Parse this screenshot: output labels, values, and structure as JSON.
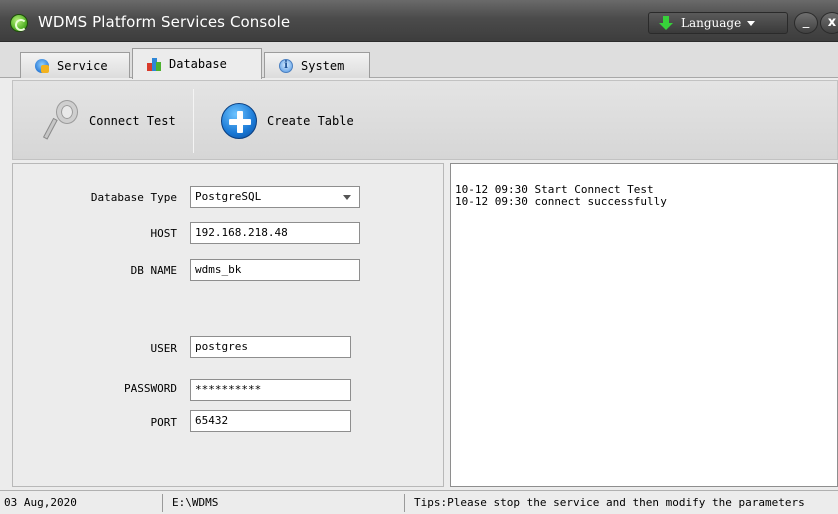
{
  "window": {
    "title": "WDMS Platform Services Console",
    "language_label": "Language",
    "minimize_glyph": "_",
    "close_glyph": "x"
  },
  "tabs": [
    {
      "label": "Service",
      "icon": "service-icon",
      "active": false
    },
    {
      "label": "Database",
      "icon": "database-icon",
      "active": true
    },
    {
      "label": "System",
      "icon": "info-icon",
      "active": false
    }
  ],
  "toolbar": {
    "connect_test_label": "Connect Test",
    "create_table_label": "Create Table"
  },
  "form": {
    "database_type_label": "Database Type",
    "database_type_value": "PostgreSQL",
    "host_label": "HOST",
    "host_value": "192.168.218.48",
    "db_name_label": "DB NAME",
    "db_name_value": "wdms_bk",
    "user_label": "USER",
    "user_value": "postgres",
    "password_label": "PASSWORD",
    "password_value": "**********",
    "port_label": "PORT",
    "port_value": "65432"
  },
  "log": {
    "lines": [
      "10-12 09:30 Start Connect Test",
      "10-12 09:30 connect successfully"
    ]
  },
  "status": {
    "date": "03 Aug,2020",
    "path": "E:\\WDMS",
    "tips": "Tips:Please stop the service and then modify the parameters"
  },
  "colors": {
    "titlebar": "#4b4b4b",
    "language_arrow": "#37d13a",
    "create_table_icon": "#1a79d6"
  }
}
